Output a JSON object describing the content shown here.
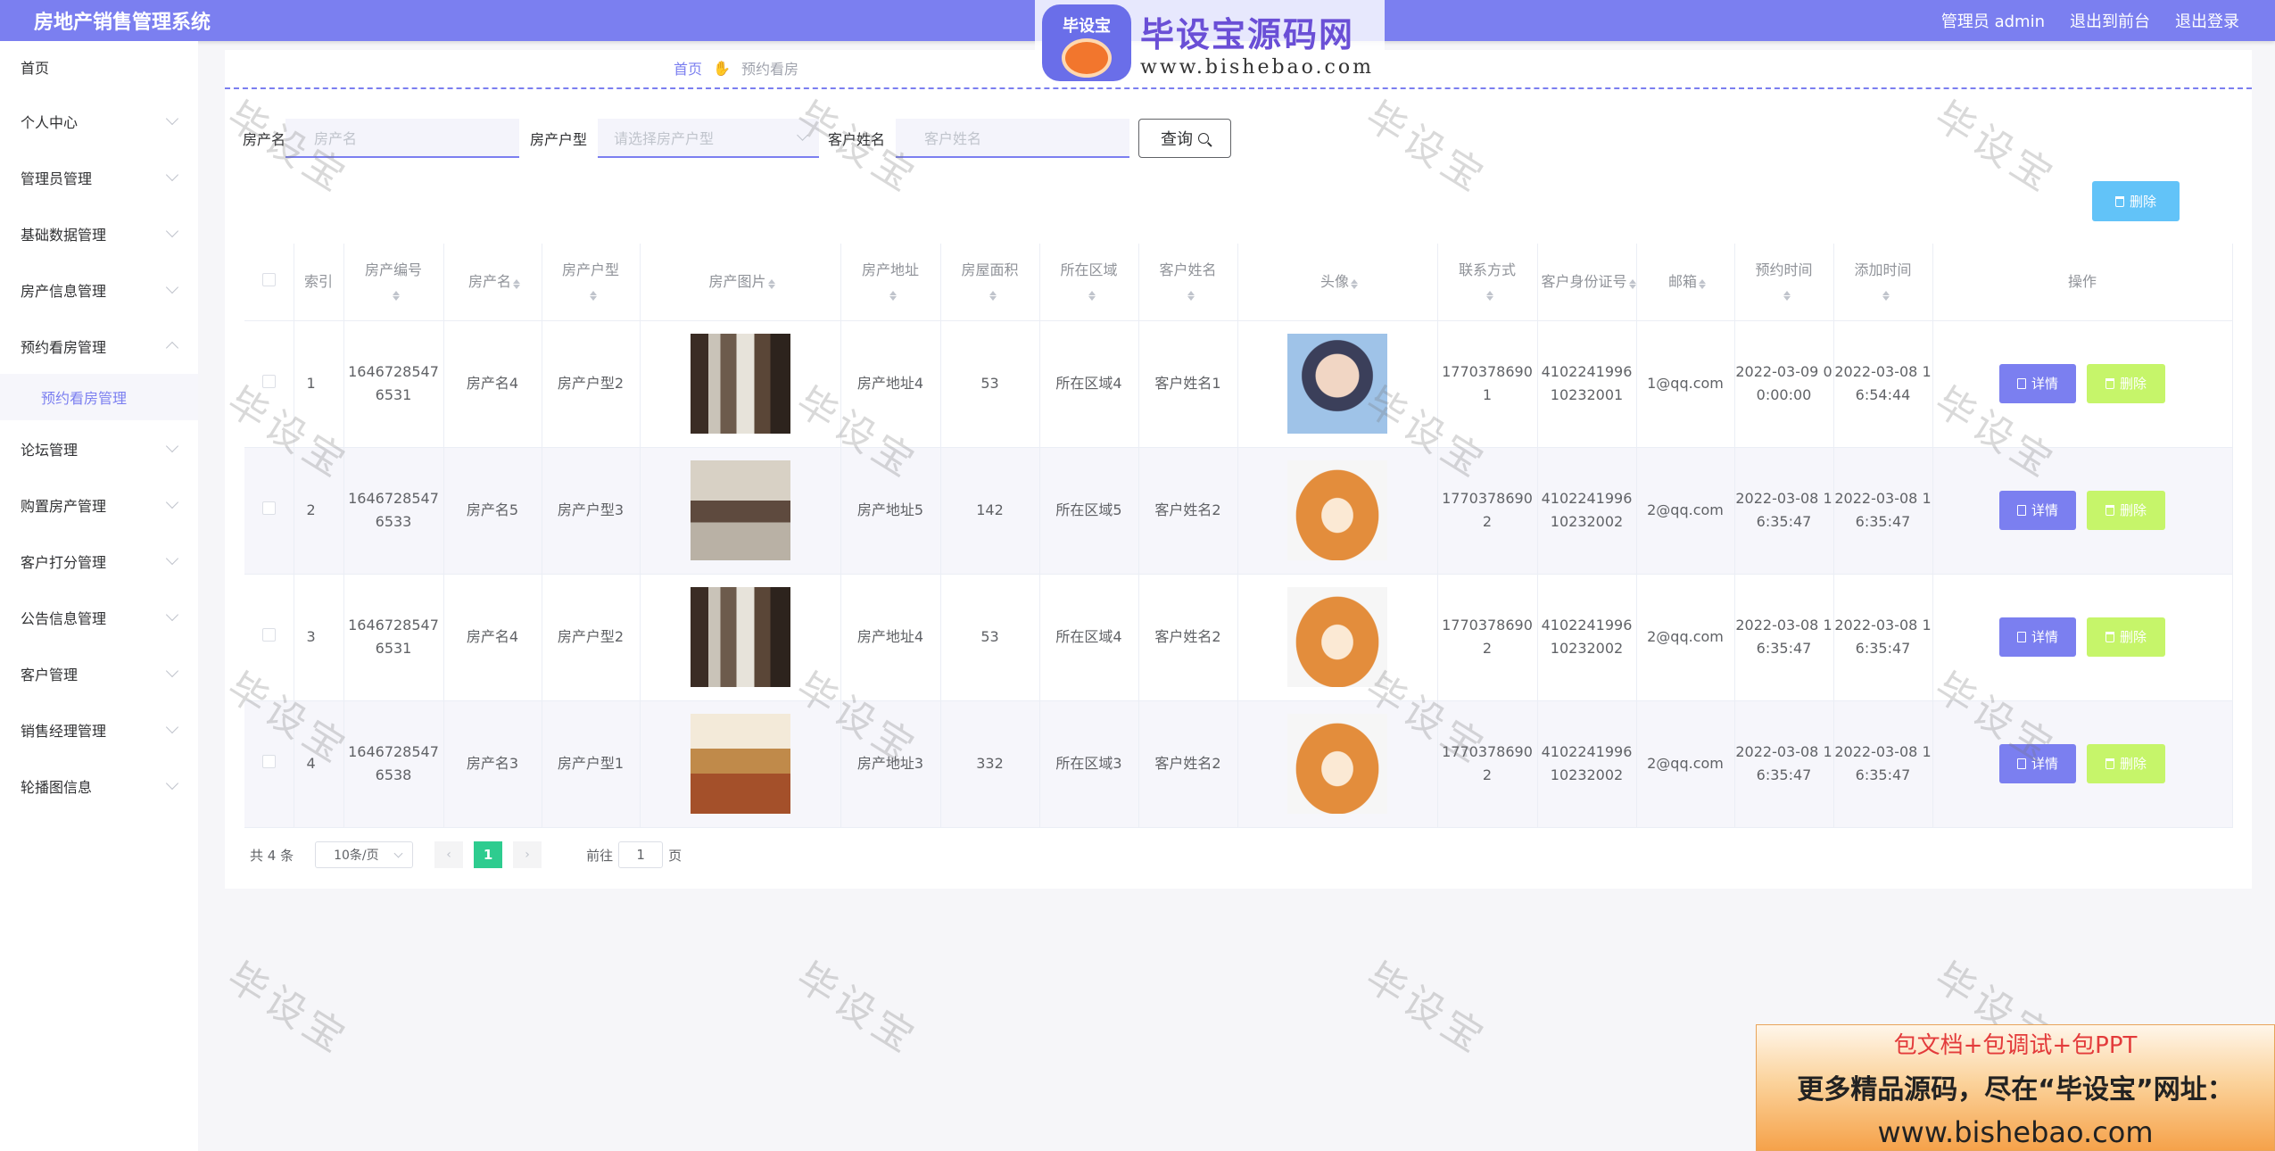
{
  "app": {
    "title": "房地产销售管理系统",
    "user": "管理员 admin",
    "to_front": "退出到前台",
    "logout": "退出登录"
  },
  "logo": {
    "badge": "毕设宝",
    "name": "毕设宝源码网",
    "url": "www.bishebao.com"
  },
  "sidebar": {
    "items": [
      {
        "label": "首页"
      },
      {
        "label": "个人中心"
      },
      {
        "label": "管理员管理"
      },
      {
        "label": "基础数据管理"
      },
      {
        "label": "房产信息管理"
      },
      {
        "label": "预约看房管理"
      },
      {
        "label": "论坛管理"
      },
      {
        "label": "购置房产管理"
      },
      {
        "label": "客户打分管理"
      },
      {
        "label": "公告信息管理"
      },
      {
        "label": "客户管理"
      },
      {
        "label": "销售经理管理"
      },
      {
        "label": "轮播图信息"
      }
    ],
    "sub_active": "预约看房管理"
  },
  "breadcrumb": {
    "home": "首页",
    "current": "预约看房"
  },
  "search": {
    "f1_label": "房产名",
    "f1_placeholder": "房产名",
    "f2_label": "房产户型",
    "f2_placeholder": "请选择房产户型",
    "f3_label": "客户姓名",
    "f3_placeholder": "客户姓名",
    "query": "查询"
  },
  "actions": {
    "delete": "删除",
    "detail": "详情"
  },
  "table": {
    "headers": [
      "索引",
      "房产编号",
      "房产名",
      "房产户型",
      "房产图片",
      "房产地址",
      "房屋面积",
      "所在区域",
      "客户姓名",
      "头像",
      "联系方式",
      "客户身份证号",
      "邮箱",
      "预约时间",
      "添加时间",
      "操作"
    ],
    "rows": [
      {
        "idx": "1",
        "code": "16467285476531",
        "name": "房产名4",
        "type": "房产户型2",
        "addr": "房产地址4",
        "area": "53",
        "region": "所在区域4",
        "customer": "客户姓名1",
        "phone": "17703786901",
        "idcard": "410224199610232001",
        "email": "1@qq.com",
        "appt": "2022-03-09 00:00:00",
        "added": "2022-03-08 16:54:44"
      },
      {
        "idx": "2",
        "code": "16467285476533",
        "name": "房产名5",
        "type": "房产户型3",
        "addr": "房产地址5",
        "area": "142",
        "region": "所在区域5",
        "customer": "客户姓名2",
        "phone": "17703786902",
        "idcard": "410224199610232002",
        "email": "2@qq.com",
        "appt": "2022-03-08 16:35:47",
        "added": "2022-03-08 16:35:47"
      },
      {
        "idx": "3",
        "code": "16467285476531",
        "name": "房产名4",
        "type": "房产户型2",
        "addr": "房产地址4",
        "area": "53",
        "region": "所在区域4",
        "customer": "客户姓名2",
        "phone": "17703786902",
        "idcard": "410224199610232002",
        "email": "2@qq.com",
        "appt": "2022-03-08 16:35:47",
        "added": "2022-03-08 16:35:47"
      },
      {
        "idx": "4",
        "code": "16467285476538",
        "name": "房产名3",
        "type": "房产户型1",
        "addr": "房产地址3",
        "area": "332",
        "region": "所在区域3",
        "customer": "客户姓名2",
        "phone": "17703786902",
        "idcard": "410224199610232002",
        "email": "2@qq.com",
        "appt": "2022-03-08 16:35:47",
        "added": "2022-03-08 16:35:47"
      }
    ]
  },
  "pager": {
    "total": "共 4 条",
    "size": "10条/页",
    "page": "1",
    "goto": "前往",
    "goto_value": "1",
    "page_unit": "页"
  },
  "watermark": "毕设宝",
  "ad": {
    "line1": "包文档+包调试+包PPT",
    "line2": "更多精品源码，尽在“毕设宝”网址：",
    "line3": "www.bishebao.com"
  }
}
